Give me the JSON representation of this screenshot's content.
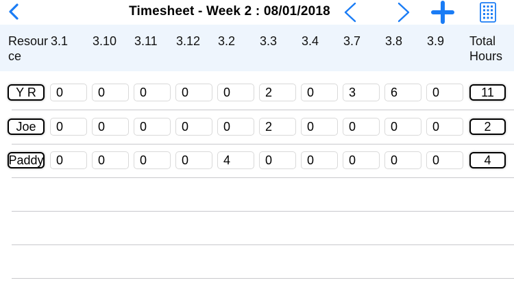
{
  "nav": {
    "title": "Timesheet - Week 2 : 08/01/2018",
    "back_icon": "chevron-left-icon",
    "prev_icon": "chevron-left-icon",
    "next_icon": "chevron-right-icon",
    "add_icon": "plus-icon",
    "grid_icon": "calculator-grid-icon",
    "accent_color": "#1a7cf5"
  },
  "table": {
    "header_bg": "#eef5fd",
    "resource_header": "Resource",
    "total_header": "Total Hours",
    "columns": [
      "3.1",
      "3.10",
      "3.11",
      "3.12",
      "3.2",
      "3.3",
      "3.4",
      "3.7",
      "3.8",
      "3.9"
    ],
    "rows": [
      {
        "resource": "Y R",
        "values": [
          "0",
          "0",
          "0",
          "0",
          "0",
          "2",
          "0",
          "3",
          "6",
          "0"
        ],
        "total": "11"
      },
      {
        "resource": "Joe",
        "values": [
          "0",
          "0",
          "0",
          "0",
          "0",
          "2",
          "0",
          "0",
          "0",
          "0"
        ],
        "total": "2"
      },
      {
        "resource": "Paddy",
        "values": [
          "0",
          "0",
          "0",
          "0",
          "4",
          "0",
          "0",
          "0",
          "0",
          "0"
        ],
        "total": "4"
      }
    ]
  }
}
